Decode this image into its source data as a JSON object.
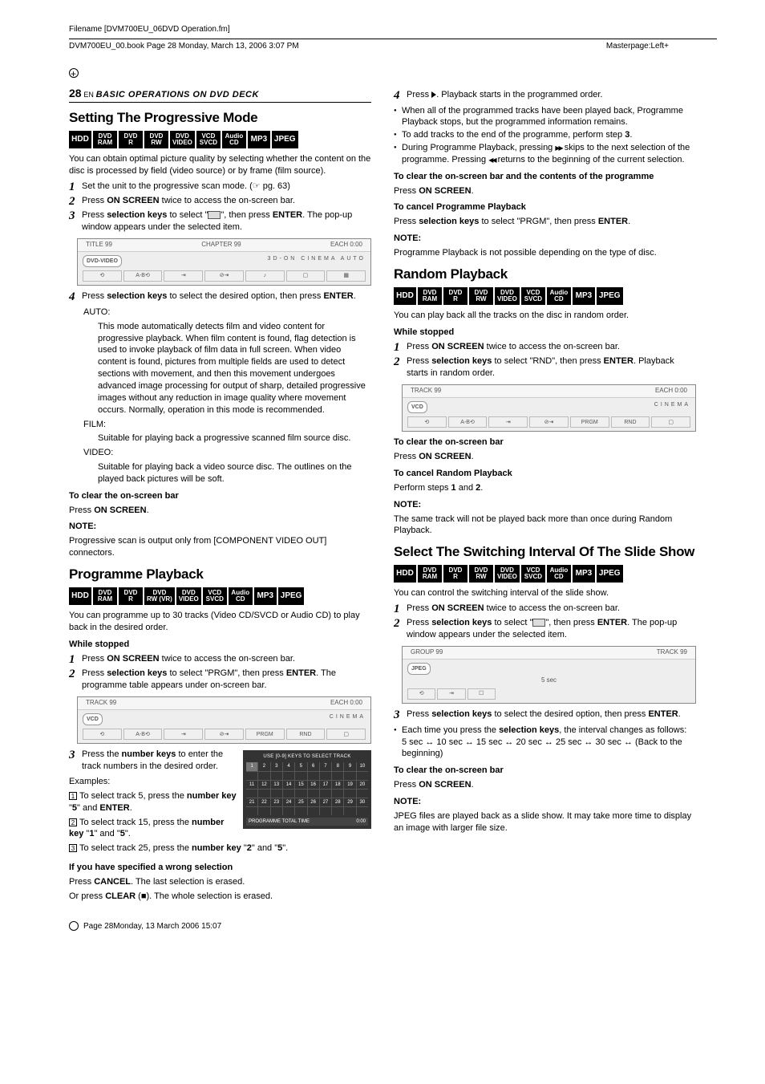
{
  "meta": {
    "filename": "Filename [DVM700EU_06DVD Operation.fm]",
    "bookline": "DVM700EU_00.book  Page 28  Monday, March 13, 2006  3:07 PM",
    "masterpage": "Masterpage:Left+",
    "footer": "Page 28Monday, 13 March 2006  15:07"
  },
  "page": {
    "num": "28",
    "lang": "EN",
    "chapter": "BASIC OPERATIONS ON DVD DECK"
  },
  "formats": {
    "hdd": "HDD",
    "dvdram": [
      "DVD",
      "RAM"
    ],
    "dvdr": [
      "DVD",
      "R"
    ],
    "dvdrw": [
      "DVD",
      "RW"
    ],
    "dvdrwvr": [
      "DVD",
      "RW (VR)"
    ],
    "dvdvideo": [
      "DVD",
      "VIDEO"
    ],
    "vcdsvcd": [
      "VCD",
      "SVCD"
    ],
    "audiocd": [
      "Audio",
      "CD"
    ],
    "mp3": "MP3",
    "jpeg": "JPEG"
  },
  "s1": {
    "title": "Setting The Progressive Mode",
    "intro": "You can obtain optimal picture quality by selecting whether the content on the disc is processed by field (video source) or by frame (film source).",
    "steps": [
      "Set the unit to the progressive scan mode. (☞ pg. 63)",
      "Press ON SCREEN twice to access the on-screen bar.",
      "Press selection keys to select \" \", then press ENTER. The pop-up window appears under the selected item.",
      "Press selection keys to select the desired option, then press ENTER."
    ],
    "osd": {
      "hdr": [
        "TITLE 99",
        "CHAPTER 99",
        "EACH 0:00"
      ],
      "badge": "DVD-VIDEO",
      "right": "3D-ON   CINEMA   AUTO"
    },
    "modes": {
      "auto_h": "AUTO:",
      "auto_t": "This mode automatically detects film and video content for progressive playback. When film content is found, flag detection is used to invoke playback of film data in full screen. When video content is found, pictures from multiple fields are used to detect sections with movement, and then this movement undergoes advanced image processing for output of sharp, detailed progressive images without any reduction in image quality where movement occurs. Normally, operation in this mode is recommended.",
      "film_h": "FILM:",
      "film_t": "Suitable for playing back a progressive scanned film source disc.",
      "video_h": "VIDEO:",
      "video_t": "Suitable for playing back a video source disc. The outlines on the played back pictures will be soft."
    },
    "clear_h": "To clear the on-screen bar",
    "clear_t": "Press ON SCREEN.",
    "note_h": "NOTE:",
    "note_t": "Progressive scan is output only from [COMPONENT VIDEO OUT] connectors."
  },
  "s2": {
    "title": "Programme Playback",
    "intro": "You can programme up to 30 tracks (Video CD/SVCD or Audio CD) to play back in the desired order.",
    "stopped_h": "While stopped",
    "steps": [
      "Press ON SCREEN twice to access the on-screen bar.",
      "Press selection keys to select \"PRGM\", then press ENTER. The programme table appears under on-screen bar.",
      "Press the number keys to enter the track numbers in the desired order."
    ],
    "osd": {
      "hdr": [
        "TRACK 99",
        "EACH 0:00"
      ],
      "badge": "VCD",
      "right": "CINEMA",
      "buttons": [
        "⟲",
        "A-B⟲",
        "⇥",
        "⊘⇥",
        "PRGM",
        "RND",
        "▢"
      ]
    },
    "examples_h": "Examples:",
    "ex1": "To select track 5, press the number key \"5\" and ENTER.",
    "ex2": "To select track 15, press the number key \"1\" and \"5\".",
    "ex3": "To select track 25, press the number key \"2\" and \"5\".",
    "prog_table": {
      "hdr": "USE [0-9] KEYS TO SELECT TRACK",
      "rows": [
        [
          "1",
          "2",
          "3",
          "4",
          "5",
          "6",
          "7",
          "8",
          "9",
          "10"
        ],
        [
          "11",
          "12",
          "13",
          "14",
          "15",
          "16",
          "17",
          "18",
          "19",
          "20"
        ],
        [
          "21",
          "22",
          "23",
          "24",
          "25",
          "26",
          "27",
          "28",
          "29",
          "30"
        ]
      ],
      "foot_l": "PROGRAMME TOTAL TIME",
      "foot_r": "0:00"
    },
    "wrong_h": "If you have specified a wrong selection",
    "wrong_t1": "Press CANCEL. The last selection is erased.",
    "wrong_t2": "Or press CLEAR (■). The whole selection is erased."
  },
  "r1": {
    "step4": "Press  . Playback starts in the programmed order.",
    "bul1": "When all of the programmed tracks have been played back, Programme Playback stops, but the programmed information remains.",
    "bul2_pre": "To add tracks to the end of the programme, perform step ",
    "bul2_num": "3",
    "bul2_post": ".",
    "bul3": "During Programme Playback, pressing  skips to the next selection of the programme. Pressing  returns to the beginning of the current selection.",
    "clear_h": "To clear the on-screen bar and the contents of the programme",
    "clear_t": "Press ON SCREEN.",
    "cancel_h": "To cancel Programme Playback",
    "cancel_t": "Press selection keys to select \"PRGM\", then press ENTER.",
    "note_h": "NOTE:",
    "note_t": "Programme Playback is not possible depending on the type of disc."
  },
  "s3": {
    "title": "Random Playback",
    "intro": "You can play back all the tracks on the disc in random order.",
    "stopped_h": "While stopped",
    "steps": [
      "Press ON SCREEN twice to access the on-screen bar.",
      "Press selection keys to select \"RND\", then press ENTER. Playback starts in random order."
    ],
    "osd": {
      "hdr": [
        "TRACK 99",
        "EACH 0:00"
      ],
      "badge": "VCD",
      "right": "CINEMA",
      "buttons": [
        "⟲",
        "A-B⟲",
        "⇥",
        "⊘⇥",
        "PRGM",
        "RND",
        "▢"
      ]
    },
    "clear_h": "To clear the on-screen bar",
    "clear_t": "Press ON SCREEN.",
    "cancel_h": "To cancel Random Playback",
    "cancel_t": "Perform steps 1 and 2.",
    "note_h": "NOTE:",
    "note_t": "The same track will not be played back more than once during Random Playback."
  },
  "s4": {
    "title": "Select The Switching Interval Of The Slide Show",
    "intro": "You can control the switching interval of the slide show.",
    "steps": [
      "Press ON SCREEN twice to access the on-screen bar.",
      "Press selection keys to select \" \", then press ENTER. The pop-up window appears under the selected item.",
      "Press selection keys to select the desired option, then press ENTER."
    ],
    "osd": {
      "hdr": [
        "GROUP 99",
        "TRACK 99"
      ],
      "badge": "JPEG",
      "center": "5 sec",
      "buttons": [
        "⟲",
        "⇥",
        "☐"
      ]
    },
    "bul_h": "Each time you press the selection keys, the interval changes as follows:",
    "intervals": "5 sec ↔ 10 sec ↔ 15 sec ↔ 20 sec ↔ 25 sec ↔ 30 sec ↔ (Back to the beginning)",
    "clear_h": "To clear the on-screen bar",
    "clear_t": "Press ON SCREEN.",
    "note_h": "NOTE:",
    "note_t": "JPEG files are played back as a slide show. It may take more time to display an image with larger file size."
  }
}
